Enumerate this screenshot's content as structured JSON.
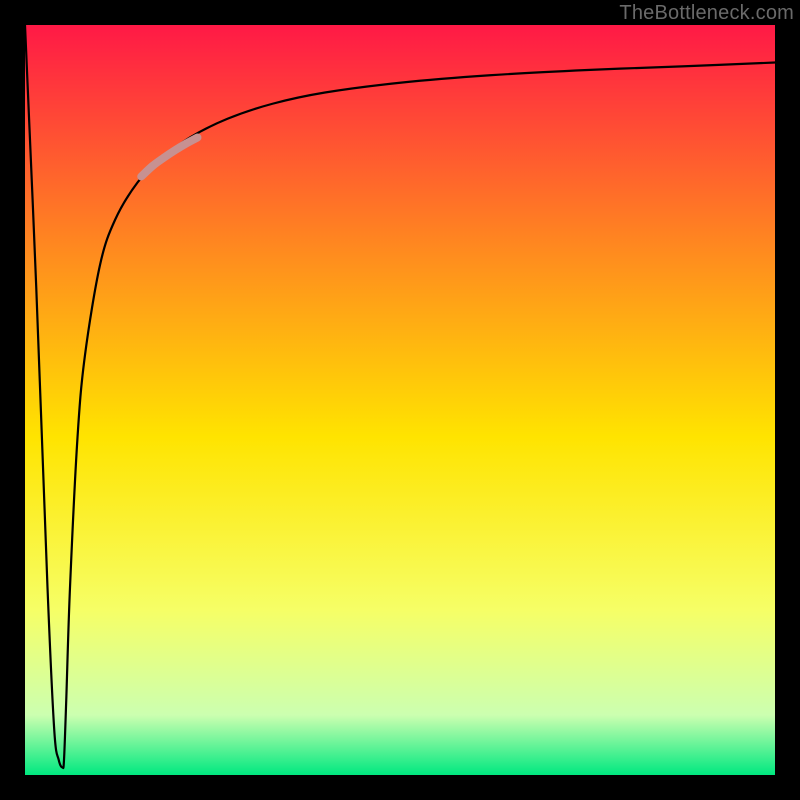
{
  "attribution": "TheBottleneck.com",
  "chart_data": {
    "type": "line",
    "title": "",
    "xlabel": "",
    "ylabel": "",
    "xlim": [
      0,
      100
    ],
    "ylim": [
      0,
      100
    ],
    "grid": false,
    "background_gradient": {
      "top": "#ff1946",
      "upper_mid": "#ff8a1f",
      "mid": "#ffe400",
      "lower_mid": "#f6ff66",
      "near_bottom": "#ccffb0",
      "bottom": "#00e880"
    },
    "series": [
      {
        "name": "bottleneck-curve",
        "x": [
          0,
          1.5,
          3.0,
          3.9,
          4.5,
          5.0,
          5.2,
          5.5,
          6.0,
          7.0,
          8.0,
          10.0,
          12.0,
          15.0,
          18.0,
          22.0,
          27.0,
          33.0,
          40.0,
          50.0,
          62.0,
          75.0,
          88.0,
          100.0
        ],
        "y": [
          100,
          65,
          25,
          6,
          2,
          1,
          2,
          10,
          25,
          45,
          56,
          68,
          74,
          79,
          82,
          85,
          87.5,
          89.5,
          91,
          92.3,
          93.3,
          94,
          94.5,
          95
        ],
        "stroke": "#000000",
        "stroke_width": 2.2
      },
      {
        "name": "highlight-segment",
        "x": [
          15.5,
          17.0,
          18.5,
          20.0,
          21.5,
          23.0
        ],
        "y": [
          79.8,
          81.2,
          82.3,
          83.3,
          84.2,
          85.0
        ],
        "stroke": "#c79191",
        "stroke_width": 8
      }
    ]
  }
}
